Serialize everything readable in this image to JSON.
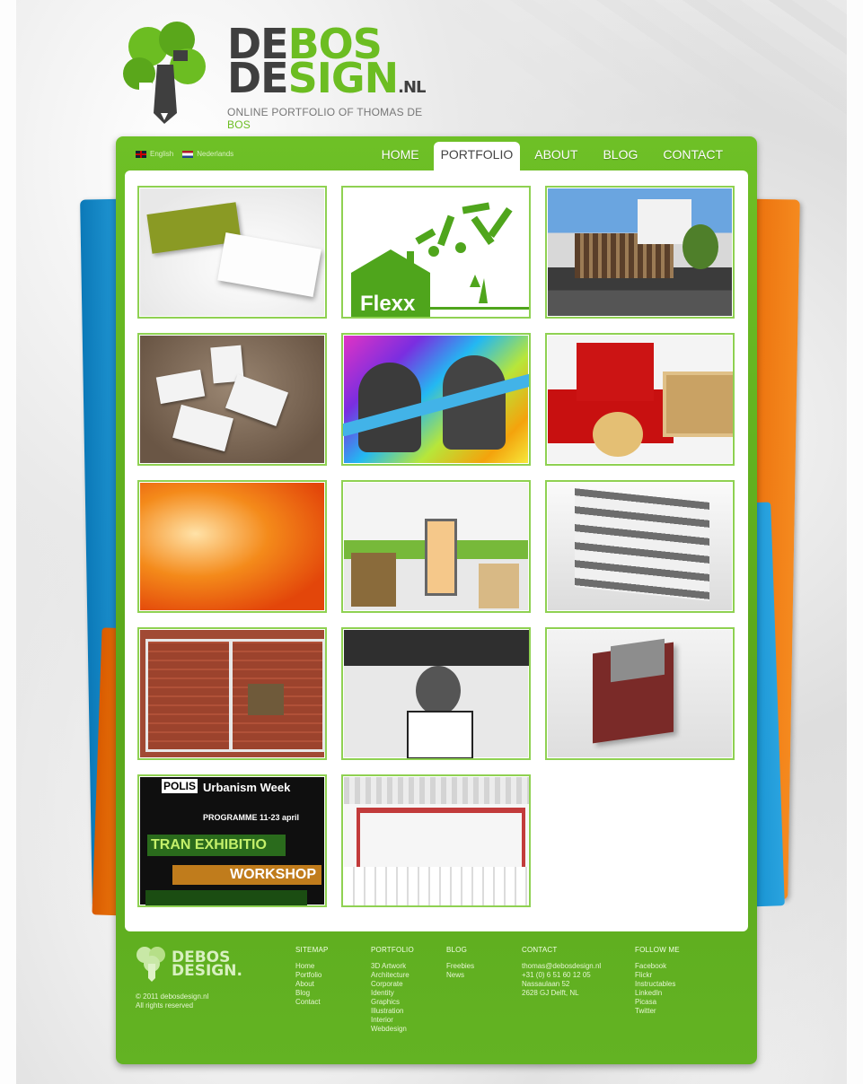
{
  "logo": {
    "line1_a": "DE",
    "line1_b": "BOS",
    "line2_a": "DE",
    "line2_b": "SIGN",
    "suffix": ".NL",
    "tagline_a": "ONLINE PORTFOLIO OF THOMAS DE ",
    "tagline_b": "BOS"
  },
  "languages": [
    {
      "label": "English"
    },
    {
      "label": "Nederlands"
    }
  ],
  "nav": [
    {
      "label": "HOME",
      "active": false
    },
    {
      "label": "PORTFOLIO",
      "active": true
    },
    {
      "label": "ABOUT",
      "active": false
    },
    {
      "label": "BLOG",
      "active": false
    },
    {
      "label": "CONTACT",
      "active": false
    }
  ],
  "thumbnails": {
    "flexx_text": "Flexx",
    "polis_label": "POLIS",
    "polis_title": "Urbanism Week",
    "polis_programme": "PROGRAMME 11-23 april",
    "polis_exhibition": "TRAN EXHIBITIO",
    "polis_workshop": "WORKSHOP"
  },
  "footer": {
    "logo_line1": "DEBOS",
    "logo_line2": "DESIGN.",
    "copyright": "© 2011 debosdesign.nl",
    "rights": "All rights reserved",
    "sitemap": {
      "heading": "SITEMAP",
      "items": [
        "Home",
        "Portfolio",
        "About",
        "Blog",
        "Contact"
      ]
    },
    "portfolio": {
      "heading": "PORTFOLIO",
      "items": [
        "3D Artwork",
        "Architecture",
        "Corporate Identity",
        "Graphics",
        "Illustration",
        "Interior",
        "Webdesign"
      ]
    },
    "blog": {
      "heading": "BLOG",
      "items": [
        "Freebies",
        "News"
      ]
    },
    "contact": {
      "heading": "CONTACT",
      "items": [
        "thomas@debosdesign.nl",
        "+31 (0) 6 51 60 12 05",
        "Nassaulaan 52",
        "2628 GJ Delft, NL"
      ]
    },
    "follow": {
      "heading": "FOLLOW ME",
      "items": [
        "Facebook",
        "Flickr",
        "Instructables",
        "LinkedIn",
        "Picasa",
        "Twitter"
      ]
    }
  },
  "colors": {
    "brand_green": "#6cbd22",
    "thumb_border": "#8fd152",
    "dark_text": "#3f3f3f"
  }
}
